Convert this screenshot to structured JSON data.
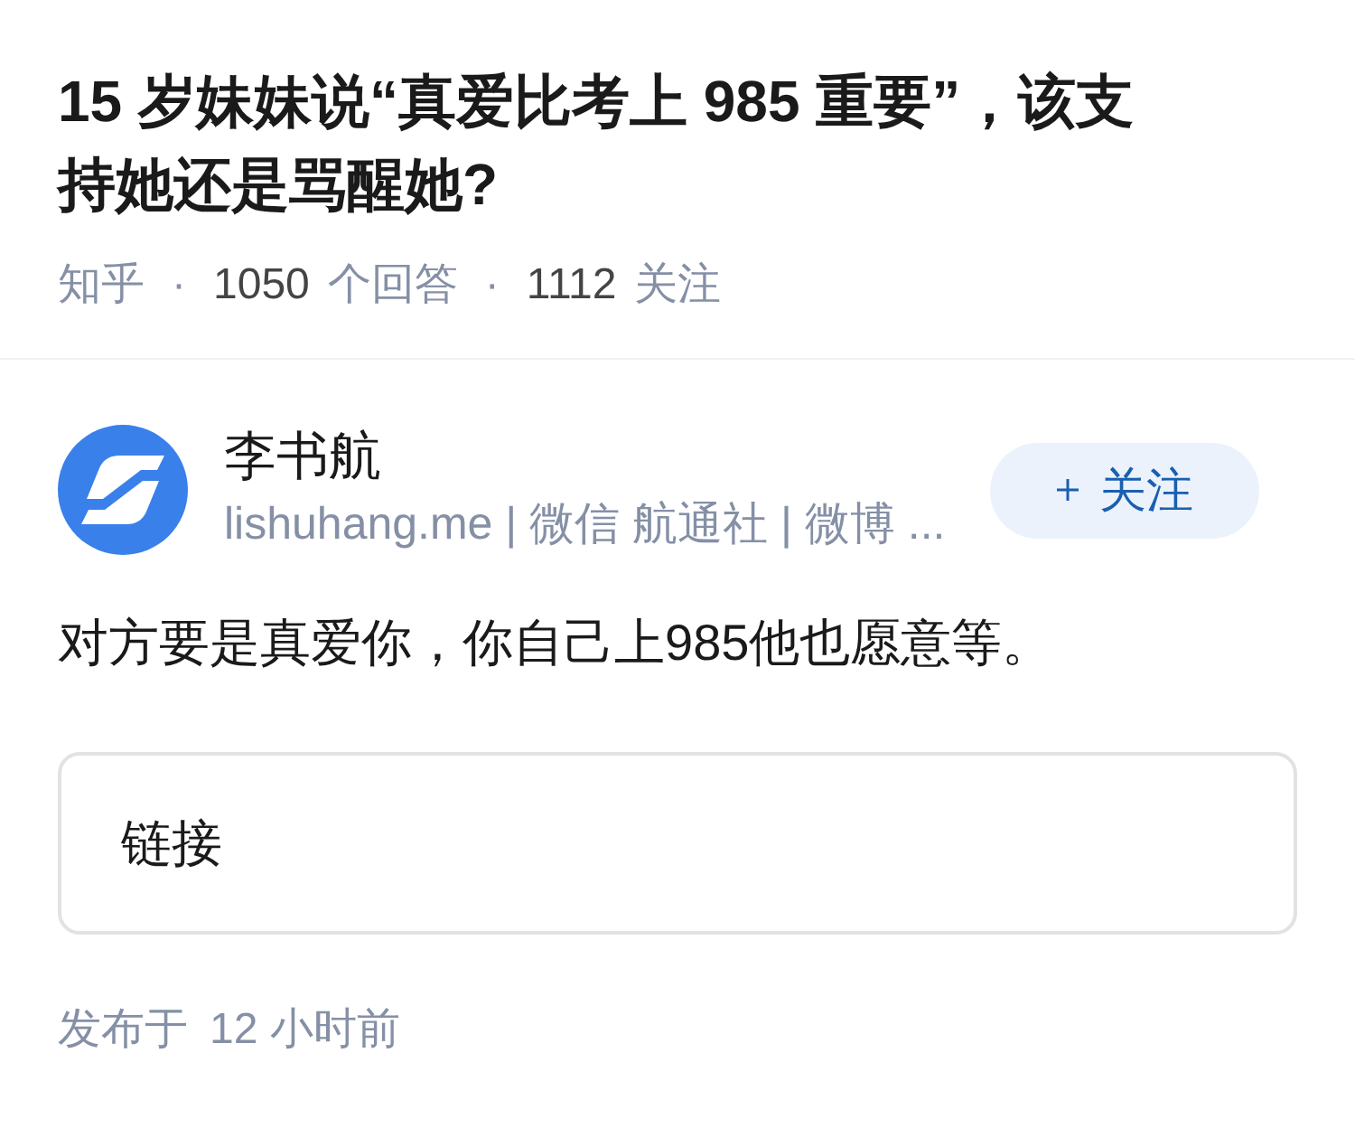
{
  "question": {
    "title": "15 岁妹妹说“真爱比考上 985 重要”，该支持她还是骂醒她?",
    "meta": [
      {
        "kind": "source",
        "text": "知乎"
      },
      {
        "kind": "separator",
        "text": "·"
      },
      {
        "kind": "count",
        "number": "1050",
        "text": "个回答"
      },
      {
        "kind": "separator",
        "text": "·"
      },
      {
        "kind": "count",
        "number": "1112",
        "text": "关注"
      }
    ]
  },
  "answer": {
    "author": {
      "name": "李书航",
      "bio": "lishuhang.me | 微信 航通社 | 微博 ...",
      "follow_button": {
        "label": "关注"
      }
    },
    "content": "对方要是真爱你，你自己上985他也愿意等。",
    "link_card": {
      "label": "链接"
    },
    "published": {
      "label": "发布于",
      "time": "12 小时前"
    }
  }
}
